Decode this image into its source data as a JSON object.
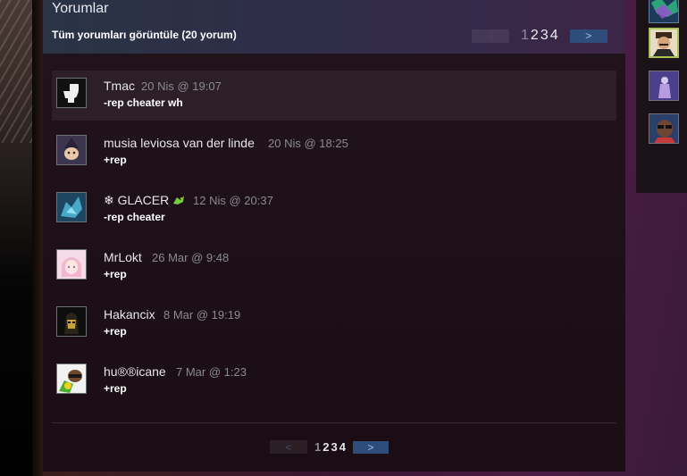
{
  "comments_section": {
    "title": "Yorumlar",
    "view_all_label": "Tüm yorumları görüntüle (20 yorum)",
    "pagination": {
      "prev_label": "<",
      "next_label": ">",
      "pages": [
        "1",
        "2",
        "3",
        "4"
      ],
      "current_page": "1"
    },
    "comments": [
      {
        "author": "Tmac",
        "time": "20 Nis @ 19:07",
        "text": "-rep cheater wh",
        "avatar_icon": "toilet-icon",
        "highlighted": true
      },
      {
        "author": "musia leviosa van der linde",
        "time": "20 Nis @ 18:25",
        "text": "+rep",
        "avatar_icon": "cartoon-witch-avatar",
        "highlighted": false
      },
      {
        "author": "❄ GLACER",
        "time": "12 Nis @ 20:37",
        "text": "-rep cheater",
        "avatar_icon": "dragon-avatar",
        "highlighted": false,
        "author_emoji": "dragon-emoji-icon"
      },
      {
        "author": "MrLokt",
        "time": "26 Mar @ 9:48",
        "text": "+rep",
        "avatar_icon": "anime-girl-avatar",
        "highlighted": false
      },
      {
        "author": "Hakancix",
        "time": "8 Mar @ 19:19",
        "text": "+rep",
        "avatar_icon": "gold-mask-avatar",
        "highlighted": false
      },
      {
        "author": "hu®®icane",
        "time": "7 Mar @ 1:23",
        "text": "+rep",
        "avatar_icon": "green-cartoon-avatar",
        "highlighted": false
      }
    ]
  },
  "friends_sidebar": {
    "avatars": [
      "green-abstract-avatar",
      "man-in-hat-avatar",
      "purple-figure-avatar",
      "man-with-glasses-avatar"
    ]
  },
  "colors": {
    "header_gradient_start": "#2a3446",
    "header_gradient_end": "#3d2547",
    "next_button": "#2f4d7a",
    "ingame_border": "#a9c35a",
    "timestamp": "#8a8a92"
  }
}
